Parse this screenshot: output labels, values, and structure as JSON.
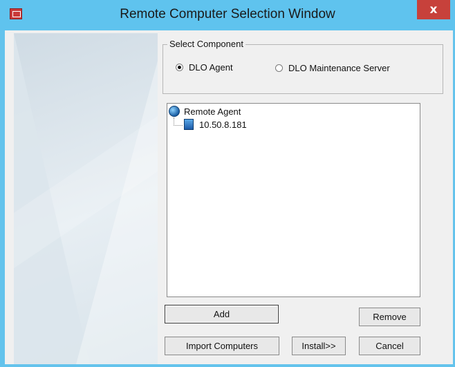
{
  "window": {
    "title": "Remote Computer Selection Window",
    "close_label": "x"
  },
  "component_group": {
    "legend": "Select Component",
    "options": [
      {
        "label": "DLO Agent",
        "selected": true
      },
      {
        "label": "DLO Maintenance Server",
        "selected": false
      }
    ]
  },
  "tree": {
    "root": {
      "label": "Remote Agent",
      "icon": "globe-icon"
    },
    "children": [
      {
        "label": "10.50.8.181",
        "icon": "computer-icon"
      }
    ]
  },
  "buttons": {
    "add": "Add",
    "remove": "Remove",
    "import_computers": "Import Computers",
    "install": "Install>>",
    "cancel": "Cancel"
  },
  "colors": {
    "titlebar": "#5fc3ee",
    "close": "#c7413b"
  }
}
